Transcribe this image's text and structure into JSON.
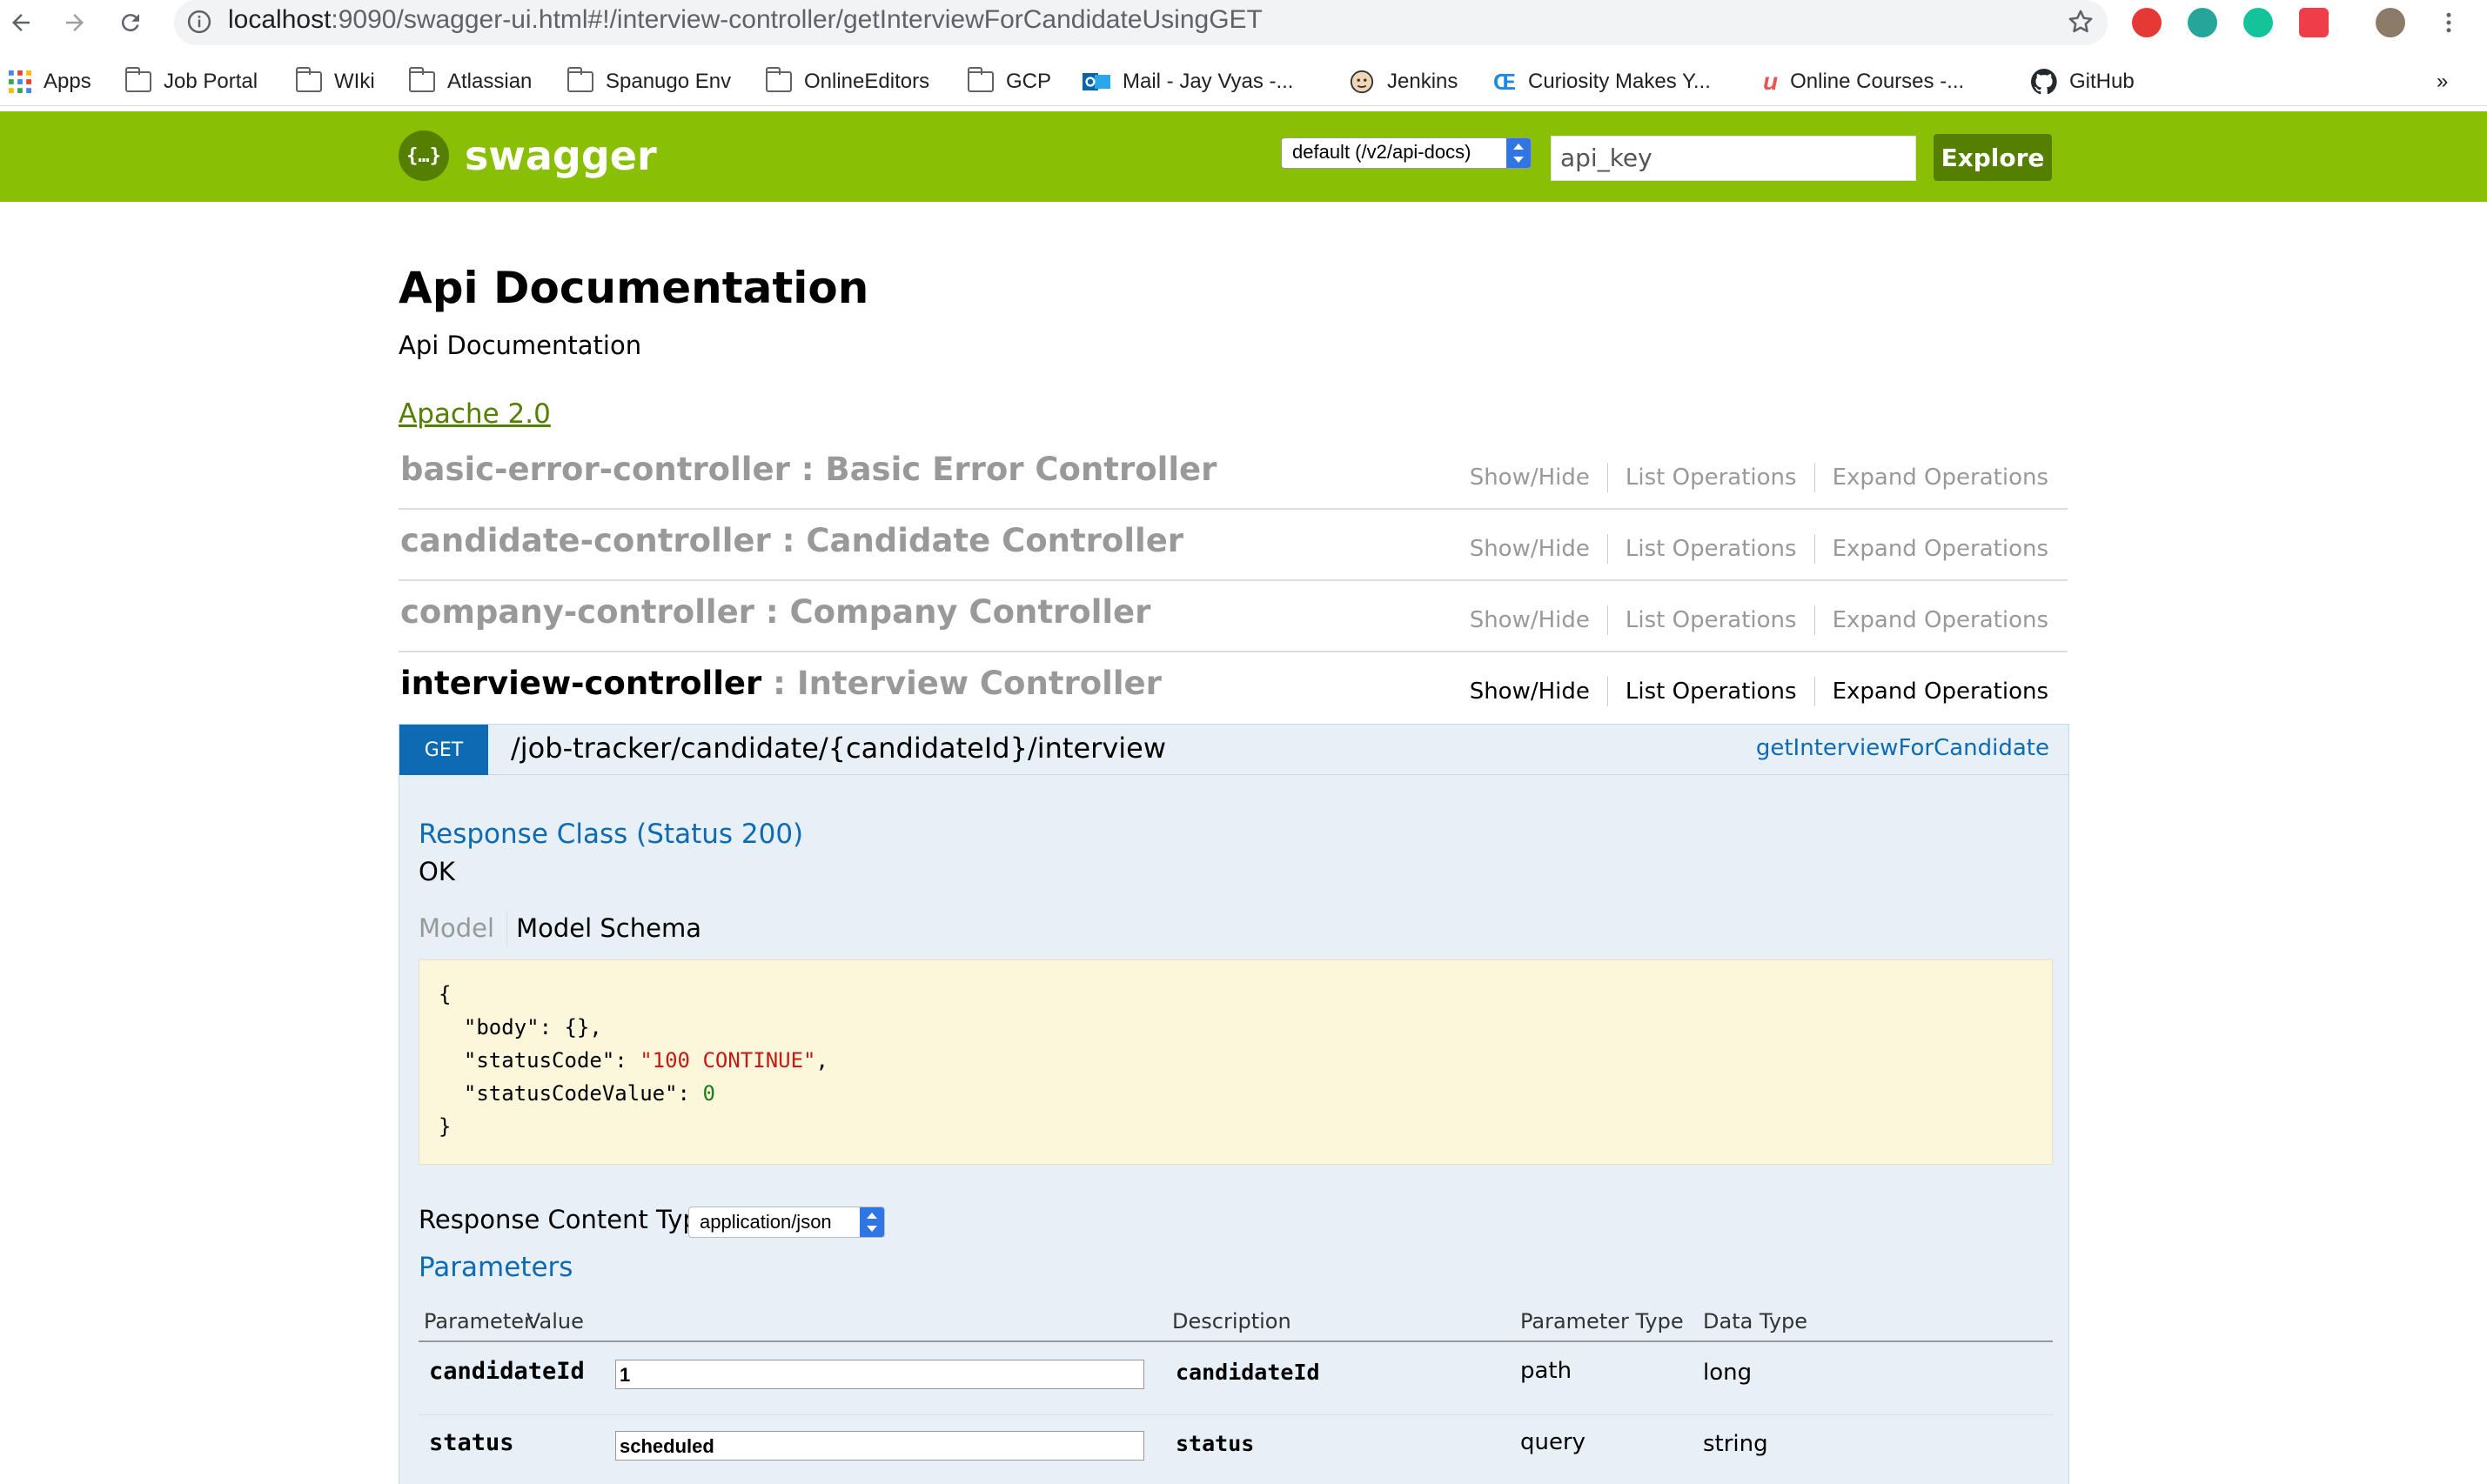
{
  "browser": {
    "url_host": "localhost",
    "url_rest": ":9090/swagger-ui.html#!/interview-controller/getInterviewForCandidateUsingGET",
    "bookmarks": [
      "Apps",
      "Job Portal",
      "WIki",
      "Atlassian",
      "Spanugo Env",
      "OnlineEditors",
      "GCP",
      "Mail - Jay Vyas -...",
      "Jenkins",
      "Curiosity Makes Y...",
      "Online Courses -...",
      "GitHub"
    ],
    "more": "»"
  },
  "swagger_header": {
    "logo_text": "swagger",
    "logo_icon": "{…}",
    "spec_select": "default (/v2/api-docs)",
    "api_key_placeholder": "api_key",
    "explore_label": "Explore"
  },
  "info": {
    "title": "Api Documentation",
    "description": "Api Documentation",
    "license": "Apache 2.0"
  },
  "resources": [
    {
      "name": "basic-error-controller",
      "separator": " : ",
      "description": "Basic Error Controller",
      "show_hide": "Show/Hide",
      "list_ops": "List Operations",
      "expand_ops": "Expand Operations"
    },
    {
      "name": "candidate-controller",
      "separator": " : ",
      "description": "Candidate Controller",
      "show_hide": "Show/Hide",
      "list_ops": "List Operations",
      "expand_ops": "Expand Operations"
    },
    {
      "name": "company-controller",
      "separator": " : ",
      "description": "Company Controller",
      "show_hide": "Show/Hide",
      "list_ops": "List Operations",
      "expand_ops": "Expand Operations"
    },
    {
      "name": "interview-controller",
      "separator": " : ",
      "description": "Interview Controller",
      "show_hide": "Show/Hide",
      "list_ops": "List Operations",
      "expand_ops": "Expand Operations"
    }
  ],
  "operation": {
    "method": "GET",
    "path": "/job-tracker/candidate/{candidateId}/interview",
    "nickname": "getInterviewForCandidate",
    "response_class_title": "Response Class (Status 200)",
    "response_class_value": "OK",
    "tab_model": "Model",
    "tab_model_schema": "Model Schema",
    "schema": {
      "open": "{",
      "body_key": "\"body\"",
      "body_val": "{}",
      "status_key": "\"statusCode\"",
      "status_val": "\"100 CONTINUE\"",
      "value_key": "\"statusCodeValue\"",
      "value_val": "0",
      "close": "}"
    },
    "content_type_label": "Response Content Type",
    "content_type_value": "application/json",
    "parameters_title": "Parameters",
    "param_headers": [
      "Parameter",
      "Value",
      "Description",
      "Parameter Type",
      "Data Type"
    ],
    "params": [
      {
        "name": "candidateId",
        "value": "1",
        "description": "candidateId",
        "param_type": "path",
        "data_type": "long"
      },
      {
        "name": "status",
        "value": "scheduled",
        "description": "status",
        "param_type": "query",
        "data_type": "string"
      }
    ]
  },
  "colors": {
    "swagger_green": "#89bf04",
    "swagger_dark_green": "#547f00",
    "get_blue": "#0f6ab4",
    "operation_bg": "#e7f0f7",
    "snippet_bg": "#fcf6db"
  }
}
